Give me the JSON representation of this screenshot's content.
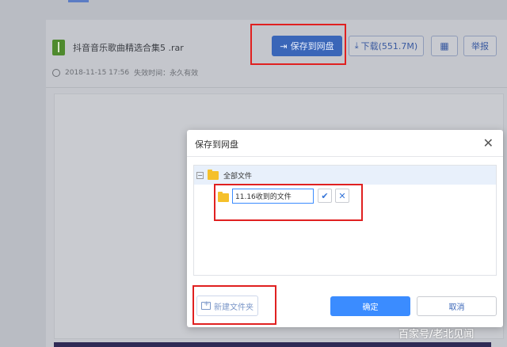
{
  "file": {
    "name": "抖音音乐歌曲精选合集5 .rar",
    "date": "2018-11-15 17:56",
    "expiry_label": "失效时间：",
    "expiry_value": "永久有效"
  },
  "toolbar": {
    "save_label": "保存到网盘",
    "download_label": "下载(551.7M)",
    "report_label": "举报"
  },
  "dialog": {
    "title": "保存到网盘",
    "tree_root": "全部文件",
    "new_folder_value": "11.16收到的文件",
    "new_folder_button": "新建文件夹",
    "confirm_label": "确定",
    "cancel_label": "取消"
  },
  "watermark": "百家号/老北见闻",
  "colors": {
    "primary": "#3b8cff",
    "highlight": "#e02020",
    "folder": "#f5c02a"
  }
}
